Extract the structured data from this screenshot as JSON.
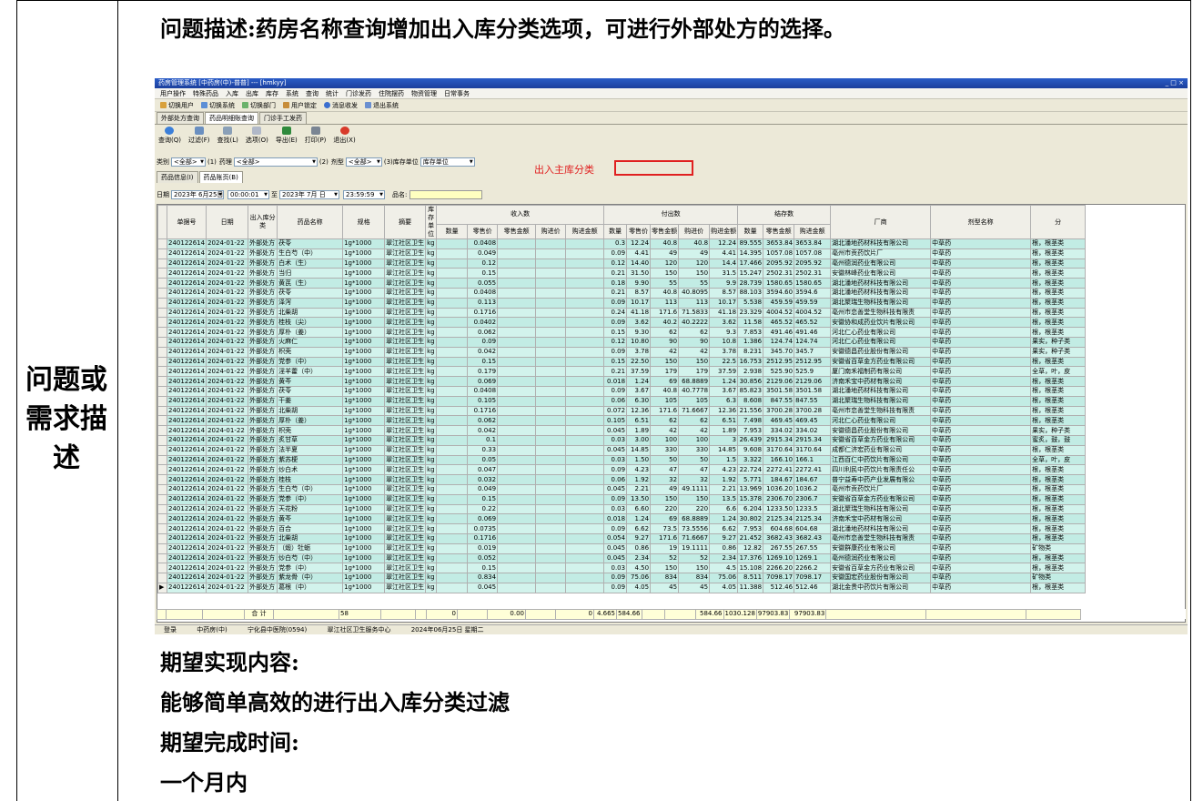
{
  "doc": {
    "title": "问题描述:药房名称查询增加出入库分类选项，可进行外部处方的选择。",
    "side_label_lines": [
      "问题或",
      "需求描",
      "述"
    ],
    "expect_label": "期望实现内容:",
    "expect_text": "能够简单高效的进行出入库分类过滤",
    "time_label": "期望完成时间:",
    "time_text": "一个月内"
  },
  "app": {
    "window_title": "药房管理系统 [中药房(中)-普普] --- [hmkyy]",
    "window_controls": "_ □ ×",
    "menu": [
      "用户操作",
      "特殊药品",
      "入库",
      "出库",
      "库存",
      "系统",
      "查询",
      "统计",
      "门诊发药",
      "住院摆药",
      "物资管理",
      "日常事务"
    ],
    "quick": [
      "切换用户",
      "切换系统",
      "切换部门",
      "用户锁定",
      "消息收发",
      "退出系统"
    ],
    "tabs": [
      "外部处方查询",
      "药品明细账查询",
      "门诊手工发药"
    ],
    "tools": [
      "查询(Q)",
      "过滤(F)",
      "查找(L)",
      "选项(O)",
      "导出(E)",
      "打印(P)",
      "退出(X)"
    ],
    "filter": {
      "category_label": "类别",
      "category_value": "<全部>",
      "k1": "(1)",
      "pharm_label": "药理",
      "pharm_value": "<全部>",
      "k2": "(2)",
      "form_label": "剂型",
      "form_value": "<全部>",
      "k3": "(3)",
      "unit_label": "库存单位",
      "unit_value": "库存单位"
    },
    "annotation": "出入主库分类",
    "subtabs": [
      "药品信息(I)",
      "药品账页(B)"
    ],
    "date": {
      "label": "日期",
      "from_date": "2023年 6月25日",
      "from_time": "00:00:01",
      "to_label": "至",
      "to_date": "2023年 7月 日",
      "to_time": "23:59:59",
      "name_label": "品名:"
    },
    "group_headers": {
      "in": "收入数",
      "out": "付出数",
      "stock": "结存数"
    },
    "headers": [
      "单据号",
      "日期",
      "出入库分类",
      "药品名称",
      "规格",
      "摘要",
      "库存单位",
      "数量",
      "零售价",
      "零售金额",
      "购进价",
      "购进金额",
      "数量",
      "零售价",
      "零售金额",
      "购进价",
      "购进金额",
      "数量",
      "零售金额",
      "购进金额",
      "厂商",
      "剂型名称",
      "分"
    ],
    "rows": [
      [
        "240122614",
        "2024-01-22",
        "外部处方",
        "茯苓",
        "1g*1000",
        "翠江社区卫生",
        "kg",
        "",
        "0.0408",
        "",
        "",
        "",
        "0.3",
        "12.24",
        "40.8",
        "40.8",
        "12.24",
        "89.555",
        "3653.84",
        "3653.84",
        "湖北潘地药材科技有限公司",
        "中草药",
        "根，根茎类"
      ],
      [
        "240122614",
        "2024-01-22",
        "外部处方",
        "生白芍（中）",
        "1g*1000",
        "翠江社区卫生",
        "kg",
        "",
        "0.049",
        "",
        "",
        "",
        "0.09",
        "4.41",
        "49",
        "49",
        "4.41",
        "14.395",
        "1057.08",
        "1057.08",
        "亳州市贡药饮片厂",
        "中草药",
        "根，根茎类"
      ],
      [
        "240122614",
        "2024-01-22",
        "外部处方",
        "白术（生）",
        "1g*1000",
        "翠江社区卫生",
        "kg",
        "",
        "0.12",
        "",
        "",
        "",
        "0.12",
        "14.40",
        "120",
        "120",
        "14.4",
        "17.466",
        "2095.92",
        "2095.92",
        "亳州德润药业有限公司",
        "中草药",
        "根，根茎类"
      ],
      [
        "240122614",
        "2024-01-22",
        "外部处方",
        "当归",
        "1g*1000",
        "翠江社区卫生",
        "kg",
        "",
        "0.15",
        "",
        "",
        "",
        "0.21",
        "31.50",
        "150",
        "150",
        "31.5",
        "15.247",
        "2502.31",
        "2502.31",
        "安徽林峰药业有限公司",
        "中草药",
        "根，根茎类"
      ],
      [
        "240122614",
        "2024-01-22",
        "外部处方",
        "黄芪（生）",
        "1g*1000",
        "翠江社区卫生",
        "kg",
        "",
        "0.055",
        "",
        "",
        "",
        "0.18",
        "9.90",
        "55",
        "55",
        "9.9",
        "28.739",
        "1580.65",
        "1580.65",
        "湖北潘地药材科技有限公司",
        "中草药",
        "根，根茎类"
      ],
      [
        "240122614",
        "2024-01-22",
        "外部处方",
        "茯苓",
        "1g*1000",
        "翠江社区卫生",
        "kg",
        "",
        "0.0408",
        "",
        "",
        "",
        "0.21",
        "8.57",
        "40.8",
        "40.8095",
        "8.57",
        "88.103",
        "3594.60",
        "3594.6",
        "湖北潘地药材科技有限公司",
        "中草药",
        "根，根茎类"
      ],
      [
        "240122614",
        "2024-01-22",
        "外部处方",
        "泽泻",
        "1g*1000",
        "翠江社区卫生",
        "kg",
        "",
        "0.113",
        "",
        "",
        "",
        "0.09",
        "10.17",
        "113",
        "113",
        "10.17",
        "5.538",
        "459.59",
        "459.59",
        "湖北聚瑞生物科技有限公司",
        "中草药",
        "根，根茎类"
      ],
      [
        "240122614",
        "2024-01-22",
        "外部处方",
        "北柴胡",
        "1g*1000",
        "翠江社区卫生",
        "kg",
        "",
        "0.1716",
        "",
        "",
        "",
        "0.24",
        "41.18",
        "171.6",
        "71.5833",
        "41.18",
        "23.329",
        "4004.52",
        "4004.52",
        "亳州市恋善堂生物科技有限责",
        "中草药",
        "根，根茎类"
      ],
      [
        "240122614",
        "2024-01-22",
        "外部处方",
        "桂枝（尖）",
        "1g*1000",
        "翠江社区卫生",
        "kg",
        "",
        "0.0402",
        "",
        "",
        "",
        "0.09",
        "3.62",
        "40.2",
        "40.2222",
        "3.62",
        "11.58",
        "465.52",
        "465.52",
        "安徽协和成药业饮片有限公司",
        "中草药",
        "根，根茎类"
      ],
      [
        "240122614",
        "2024-01-22",
        "外部处方",
        "厚朴（姜）",
        "1g*1000",
        "翠江社区卫生",
        "kg",
        "",
        "0.062",
        "",
        "",
        "",
        "0.15",
        "9.30",
        "62",
        "62",
        "9.3",
        "7.853",
        "491.46",
        "491.46",
        "河北仁心药业有限公司",
        "中草药",
        "根，根茎类"
      ],
      [
        "240122614",
        "2024-01-22",
        "外部处方",
        "火麻仁",
        "1g*1000",
        "翠江社区卫生",
        "kg",
        "",
        "0.09",
        "",
        "",
        "",
        "0.12",
        "10.80",
        "90",
        "90",
        "10.8",
        "1.386",
        "124.74",
        "124.74",
        "河北仁心药业有限公司",
        "中草药",
        "果实，种子类"
      ],
      [
        "240122614",
        "2024-01-22",
        "外部处方",
        "枳壳",
        "1g*1000",
        "翠江社区卫生",
        "kg",
        "",
        "0.042",
        "",
        "",
        "",
        "0.09",
        "3.78",
        "42",
        "42",
        "3.78",
        "8.231",
        "345.70",
        "345.7",
        "安徽德昌药业股份有限公司",
        "中草药",
        "果实，种子类"
      ],
      [
        "240122614",
        "2024-01-22",
        "外部处方",
        "党参（中）",
        "1g*1000",
        "翠江社区卫生",
        "kg",
        "",
        "0.15",
        "",
        "",
        "",
        "0.15",
        "22.50",
        "150",
        "150",
        "22.5",
        "16.753",
        "2512.95",
        "2512.95",
        "安徽省百草金方药业有限公司",
        "中草药",
        "根，根茎类"
      ],
      [
        "240122614",
        "2024-01-22",
        "外部处方",
        "淫羊藿（中）",
        "1g*1000",
        "翠江社区卫生",
        "kg",
        "",
        "0.179",
        "",
        "",
        "",
        "0.21",
        "37.59",
        "179",
        "179",
        "37.59",
        "2.938",
        "525.90",
        "525.9",
        "厦门南禾福制药有限公司",
        "中草药",
        "全草，叶，皮"
      ],
      [
        "240122614",
        "2024-01-22",
        "外部处方",
        "黄芩",
        "1g*1000",
        "翠江社区卫生",
        "kg",
        "",
        "0.069",
        "",
        "",
        "",
        "0.018",
        "1.24",
        "69",
        "68.8889",
        "1.24",
        "30.856",
        "2129.06",
        "2129.06",
        "济南禾宝中药材有限公司",
        "中草药",
        "根，根茎类"
      ],
      [
        "240122614",
        "2024-01-22",
        "外部处方",
        "茯苓",
        "1g*1000",
        "翠江社区卫生",
        "kg",
        "",
        "0.0408",
        "",
        "",
        "",
        "0.09",
        "3.67",
        "40.8",
        "40.7778",
        "3.67",
        "85.823",
        "3501.58",
        "3501.58",
        "湖北潘地药材科技有限公司",
        "中草药",
        "根，根茎类"
      ],
      [
        "240122614",
        "2024-01-22",
        "外部处方",
        "干姜",
        "1g*1000",
        "翠江社区卫生",
        "kg",
        "",
        "0.105",
        "",
        "",
        "",
        "0.06",
        "6.30",
        "105",
        "105",
        "6.3",
        "8.608",
        "847.55",
        "847.55",
        "湖北聚瑞生物科技有限公司",
        "中草药",
        "根，根茎类"
      ],
      [
        "240122614",
        "2024-01-22",
        "外部处方",
        "北柴胡",
        "1g*1000",
        "翠江社区卫生",
        "kg",
        "",
        "0.1716",
        "",
        "",
        "",
        "0.072",
        "12.36",
        "171.6",
        "71.6667",
        "12.36",
        "21.556",
        "3700.28",
        "3700.28",
        "亳州市恋善堂生物科技有限责",
        "中草药",
        "根，根茎类"
      ],
      [
        "240122614",
        "2024-01-22",
        "外部处方",
        "厚朴（姜）",
        "1g*1000",
        "翠江社区卫生",
        "kg",
        "",
        "0.062",
        "",
        "",
        "",
        "0.105",
        "6.51",
        "62",
        "62",
        "6.51",
        "7.498",
        "469.45",
        "469.45",
        "河北仁心药业有限公司",
        "中草药",
        "根，根茎类"
      ],
      [
        "240122614",
        "2024-01-22",
        "外部处方",
        "枳壳",
        "1g*1000",
        "翠江社区卫生",
        "kg",
        "",
        "0.042",
        "",
        "",
        "",
        "0.045",
        "1.89",
        "42",
        "42",
        "1.89",
        "7.953",
        "334.02",
        "334.02",
        "安徽德昌药业股份有限公司",
        "中草药",
        "果实，种子类"
      ],
      [
        "240122614",
        "2024-01-22",
        "外部处方",
        "炙甘草",
        "1g*1000",
        "翠江社区卫生",
        "kg",
        "",
        "0.1",
        "",
        "",
        "",
        "0.03",
        "3.00",
        "100",
        "100",
        "3",
        "26.439",
        "2915.34",
        "2915.34",
        "安徽省百草金方药业有限公司",
        "中草药",
        "蜜炙，鼓，鼓"
      ],
      [
        "240122614",
        "2024-01-22",
        "外部处方",
        "法半夏",
        "1g*1000",
        "翠江社区卫生",
        "kg",
        "",
        "0.33",
        "",
        "",
        "",
        "0.045",
        "14.85",
        "330",
        "330",
        "14.85",
        "9.608",
        "3170.64",
        "3170.64",
        "成都仁济宏药业有限公司",
        "中草药",
        "根，根茎类"
      ],
      [
        "240122614",
        "2024-01-22",
        "外部处方",
        "紫苏梗",
        "1g*1000",
        "翠江社区卫生",
        "kg",
        "",
        "0.05",
        "",
        "",
        "",
        "0.03",
        "1.50",
        "50",
        "50",
        "1.5",
        "3.322",
        "166.10",
        "166.1",
        "江西百仁中药饮片有限公司",
        "中草药",
        "全草，叶，皮"
      ],
      [
        "240122614",
        "2024-01-22",
        "外部处方",
        "炒白术",
        "1g*1000",
        "翠江社区卫生",
        "kg",
        "",
        "0.047",
        "",
        "",
        "",
        "0.09",
        "4.23",
        "47",
        "47",
        "4.23",
        "22.724",
        "2272.41",
        "2272.41",
        "四川利民中药饮片有限责任公",
        "中草药",
        "根，根茎类"
      ],
      [
        "240122614",
        "2024-01-22",
        "外部处方",
        "桂枝",
        "1g*1000",
        "翠江社区卫生",
        "kg",
        "",
        "0.032",
        "",
        "",
        "",
        "0.06",
        "1.92",
        "32",
        "32",
        "1.92",
        "5.771",
        "184.67",
        "184.67",
        "普宁益寿中药产业发展有限公",
        "中草药",
        "根，根茎类"
      ],
      [
        "240122614",
        "2024-01-22",
        "外部处方",
        "生白芍（中）",
        "1g*1000",
        "翠江社区卫生",
        "kg",
        "",
        "0.049",
        "",
        "",
        "",
        "0.045",
        "2.21",
        "49",
        "49.1111",
        "2.21",
        "13.969",
        "1036.20",
        "1036.2",
        "亳州市贡药饮片厂",
        "中草药",
        "根，根茎类"
      ],
      [
        "240122614",
        "2024-01-22",
        "外部处方",
        "党参（中）",
        "1g*1000",
        "翠江社区卫生",
        "kg",
        "",
        "0.15",
        "",
        "",
        "",
        "0.09",
        "13.50",
        "150",
        "150",
        "13.5",
        "15.378",
        "2306.70",
        "2306.7",
        "安徽省百草金方药业有限公司",
        "中草药",
        "根，根茎类"
      ],
      [
        "240122614",
        "2024-01-22",
        "外部处方",
        "天花粉",
        "1g*1000",
        "翠江社区卫生",
        "kg",
        "",
        "0.22",
        "",
        "",
        "",
        "0.03",
        "6.60",
        "220",
        "220",
        "6.6",
        "6.204",
        "1233.50",
        "1233.5",
        "湖北聚瑞生物科技有限公司",
        "中草药",
        "根，根茎类"
      ],
      [
        "240122614",
        "2024-01-22",
        "外部处方",
        "黄芩",
        "1g*1000",
        "翠江社区卫生",
        "kg",
        "",
        "0.069",
        "",
        "",
        "",
        "0.018",
        "1.24",
        "69",
        "68.8889",
        "1.24",
        "30.802",
        "2125.34",
        "2125.34",
        "济南禾宝中药材有限公司",
        "中草药",
        "根，根茎类"
      ],
      [
        "240122614",
        "2024-01-22",
        "外部处方",
        "百合",
        "1g*1000",
        "翠江社区卫生",
        "kg",
        "",
        "0.0735",
        "",
        "",
        "",
        "0.09",
        "6.62",
        "73.5",
        "73.5556",
        "6.62",
        "7.953",
        "604.68",
        "604.68",
        "湖北潘地药材科技有限公司",
        "中草药",
        "根，根茎类"
      ],
      [
        "240122614",
        "2024-01-22",
        "外部处方",
        "北柴胡",
        "1g*1000",
        "翠江社区卫生",
        "kg",
        "",
        "0.1716",
        "",
        "",
        "",
        "0.054",
        "9.27",
        "171.6",
        "71.6667",
        "9.27",
        "21.452",
        "3682.43",
        "3682.43",
        "亳州市恋善堂生物科技有限责",
        "中草药",
        "根，根茎类"
      ],
      [
        "240122614",
        "2024-01-22",
        "外部处方",
        "（煅）牡蛎",
        "1g*1000",
        "翠江社区卫生",
        "kg",
        "",
        "0.019",
        "",
        "",
        "",
        "0.045",
        "0.86",
        "19",
        "19.1111",
        "0.86",
        "12.82",
        "267.55",
        "267.55",
        "安徽群康药业有限公司",
        "中草药",
        "矿物类"
      ],
      [
        "240122614",
        "2024-01-22",
        "外部处方",
        "炒白芍（中）",
        "1g*1000",
        "翠江社区卫生",
        "kg",
        "",
        "0.052",
        "",
        "",
        "",
        "0.045",
        "2.34",
        "52",
        "52",
        "2.34",
        "17.376",
        "1269.10",
        "1269.1",
        "亳州德润药业有限公司",
        "中草药",
        "根，根茎类"
      ],
      [
        "240122614",
        "2024-01-22",
        "外部处方",
        "党参（中）",
        "1g*1000",
        "翠江社区卫生",
        "kg",
        "",
        "0.15",
        "",
        "",
        "",
        "0.03",
        "4.50",
        "150",
        "150",
        "4.5",
        "15.108",
        "2266.20",
        "2266.2",
        "安徽省百草金方药业有限公司",
        "中草药",
        "根，根茎类"
      ],
      [
        "240122614",
        "2024-01-22",
        "外部处方",
        "紫龙骨（中）",
        "1g*1000",
        "翠江社区卫生",
        "kg",
        "",
        "0.834",
        "",
        "",
        "",
        "0.09",
        "75.06",
        "834",
        "834",
        "75.06",
        "8.511",
        "7098.17",
        "7098.17",
        "安徽国宏药业股份有限公司",
        "中草药",
        "矿物类"
      ],
      [
        "240122614",
        "2024-01-22",
        "外部处方",
        "葛根（中）",
        "1g*1000",
        "翠江社区卫生",
        "kg",
        "",
        "0.045",
        "",
        "",
        "",
        "0.09",
        "4.05",
        "45",
        "45",
        "4.05",
        "11.388",
        "512.46",
        "512.46",
        "湖北金贵中药饮片有限公司",
        "中草药",
        "根，根茎类"
      ]
    ],
    "totals": {
      "label": "合 计",
      "count": "58",
      "in_qty": "0",
      "in_amount": "0.00",
      "in_buy": "0",
      "out_qty": "4.665",
      "out_retail": "584.66",
      "out_buy": "584.66",
      "stock_qty": "1030.128",
      "stock_retail": "97903.83",
      "stock_buy": "97903.83"
    },
    "status": [
      "登录",
      "中药房(中)",
      "宁化县中医院(0594)",
      "翠江社区卫生服务中心",
      "2024年06月25日 星期二"
    ]
  }
}
